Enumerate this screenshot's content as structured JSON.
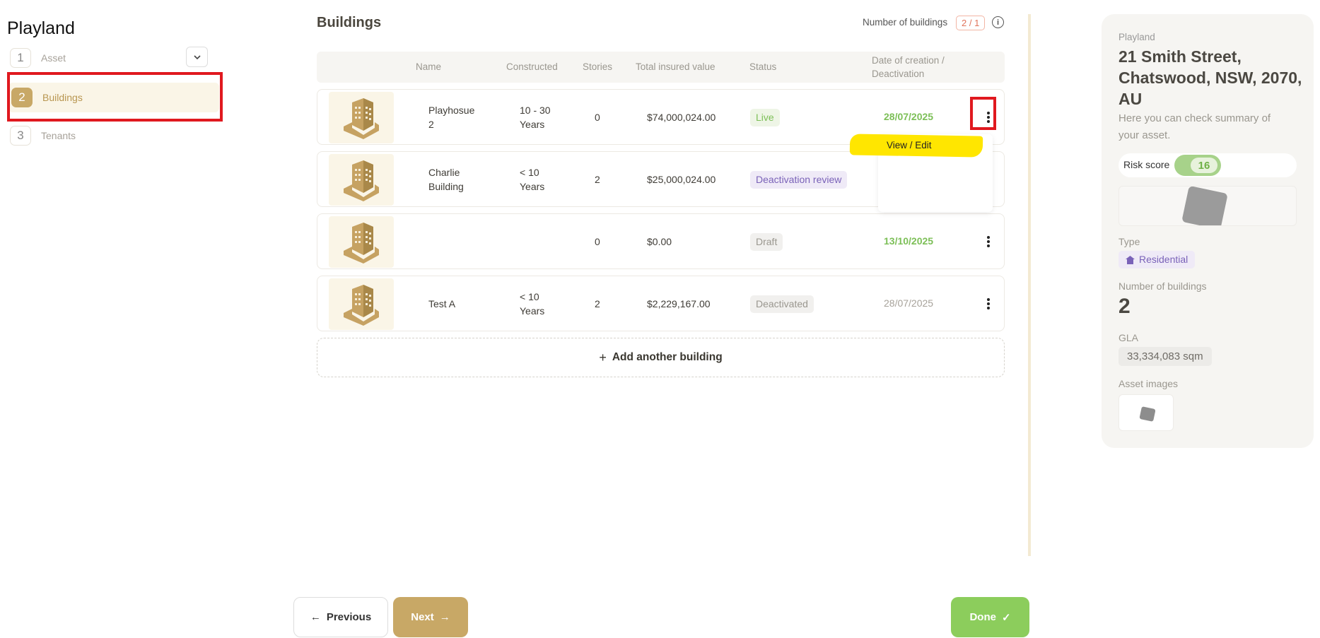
{
  "app": {
    "title": "Playland"
  },
  "steps": [
    {
      "num": "1",
      "label": "Asset"
    },
    {
      "num": "2",
      "label": "Buildings"
    },
    {
      "num": "3",
      "label": "Tenants"
    }
  ],
  "header": {
    "title": "Buildings",
    "count_label": "Number of buildings",
    "count_value": "2 / 1"
  },
  "table": {
    "columns": [
      "Name",
      "Constructed",
      "Stories",
      "Total insured value",
      "Status",
      "Date of creation /",
      "Deactivation"
    ],
    "rows": [
      {
        "name_1": "Playhosue",
        "name_2": "2",
        "constructed_1": "10 - 30",
        "constructed_2": "Years",
        "stories": "0",
        "value": "$74,000,024.00",
        "status": "Live",
        "date": "28/07/2025"
      },
      {
        "name_1": "Charlie",
        "name_2": "Building",
        "constructed_1": "< 10",
        "constructed_2": "Years",
        "stories": "2",
        "value": "$25,000,024.00",
        "status": "Deactivation review",
        "date": ""
      },
      {
        "name_1": "",
        "name_2": "",
        "constructed_1": "",
        "constructed_2": "",
        "stories": "0",
        "value": "$0.00",
        "status": "Draft",
        "date": "13/10/2025"
      },
      {
        "name_1": "Test A",
        "name_2": "",
        "constructed_1": "< 10",
        "constructed_2": "Years",
        "stories": "2",
        "value": "$2,229,167.00",
        "status": "Deactivated",
        "date": "28/07/2025"
      }
    ]
  },
  "menu": {
    "view_edit": "View / Edit"
  },
  "add_building": "Add another building",
  "footer": {
    "previous": "Previous",
    "next": "Next",
    "done": "Done"
  },
  "summary": {
    "owner": "Playland",
    "address": "21 Smith Street, Chatswood, NSW, 2070, AU",
    "subtitle": "Here you can check summary of your asset.",
    "risk_label": "Risk score",
    "risk_value": "16",
    "type_label": "Type",
    "type_value": "Residential",
    "buildings_label": "Number of buildings",
    "buildings_value": "2",
    "gla_label": "GLA",
    "gla_value": "33,334,083 sqm",
    "images_label": "Asset images"
  },
  "colors": {
    "accent": "#c8a866",
    "live": "#7cbf57",
    "done": "#8ccd5c",
    "annotation": "#e0191f",
    "highlight": "#ffe600"
  }
}
